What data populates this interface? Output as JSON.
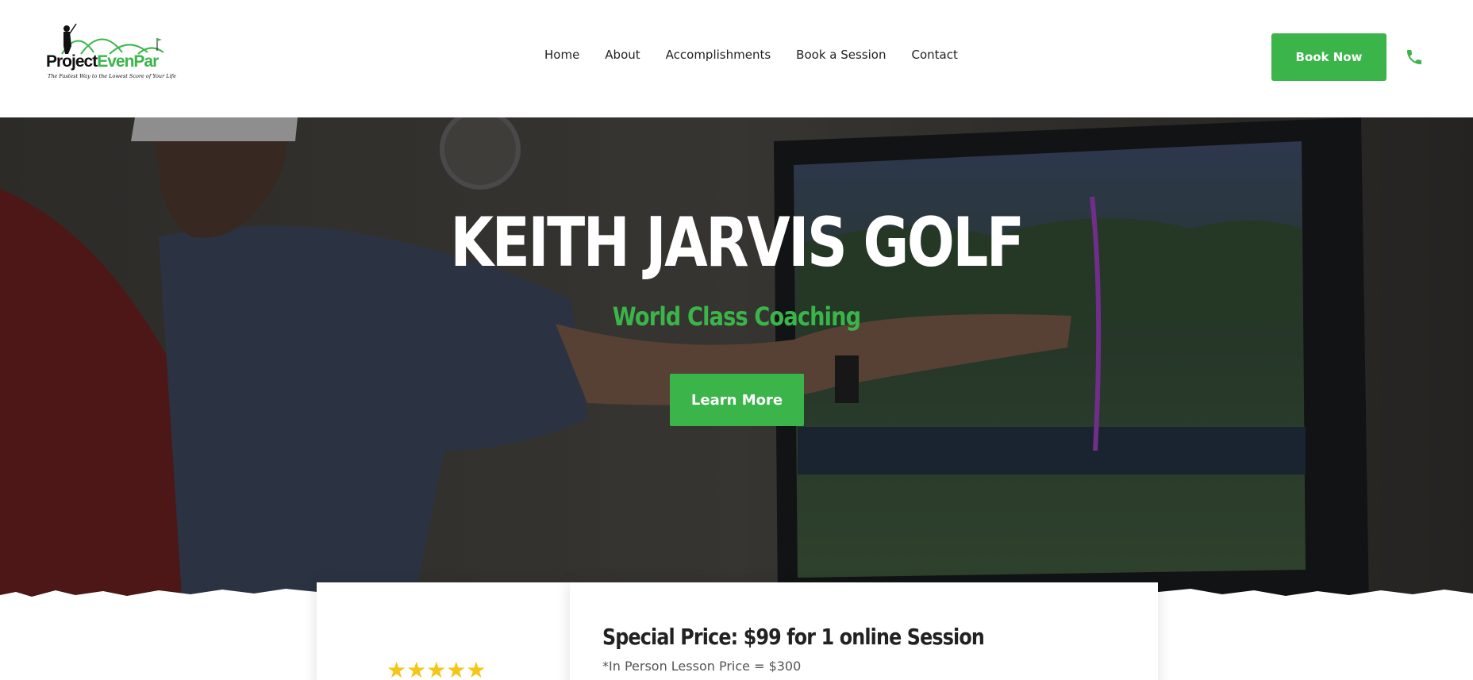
{
  "header": {
    "logo": {
      "brand_project": "Project",
      "brand_evenpar": "EvenPar",
      "tagline": "The Fastest Way to the Lowest Score of Your Life"
    },
    "nav": [
      "Home",
      "About",
      "Accomplishments",
      "Book a Session",
      "Contact"
    ],
    "book_now_label": "Book Now",
    "phone_icon": "phone-icon"
  },
  "hero": {
    "title": "KEITH JARVIS GOLF",
    "subtitle": "World Class Coaching",
    "cta_label": "Learn More"
  },
  "offer": {
    "rating_stars": "★★★★★",
    "rating_value": 5,
    "headline": "Special Price: $99 for 1 online Session",
    "note": "*In Person Lesson Price = $300"
  },
  "colors": {
    "accent": "#3bb54a",
    "star": "#f5c518",
    "text": "#222222"
  }
}
